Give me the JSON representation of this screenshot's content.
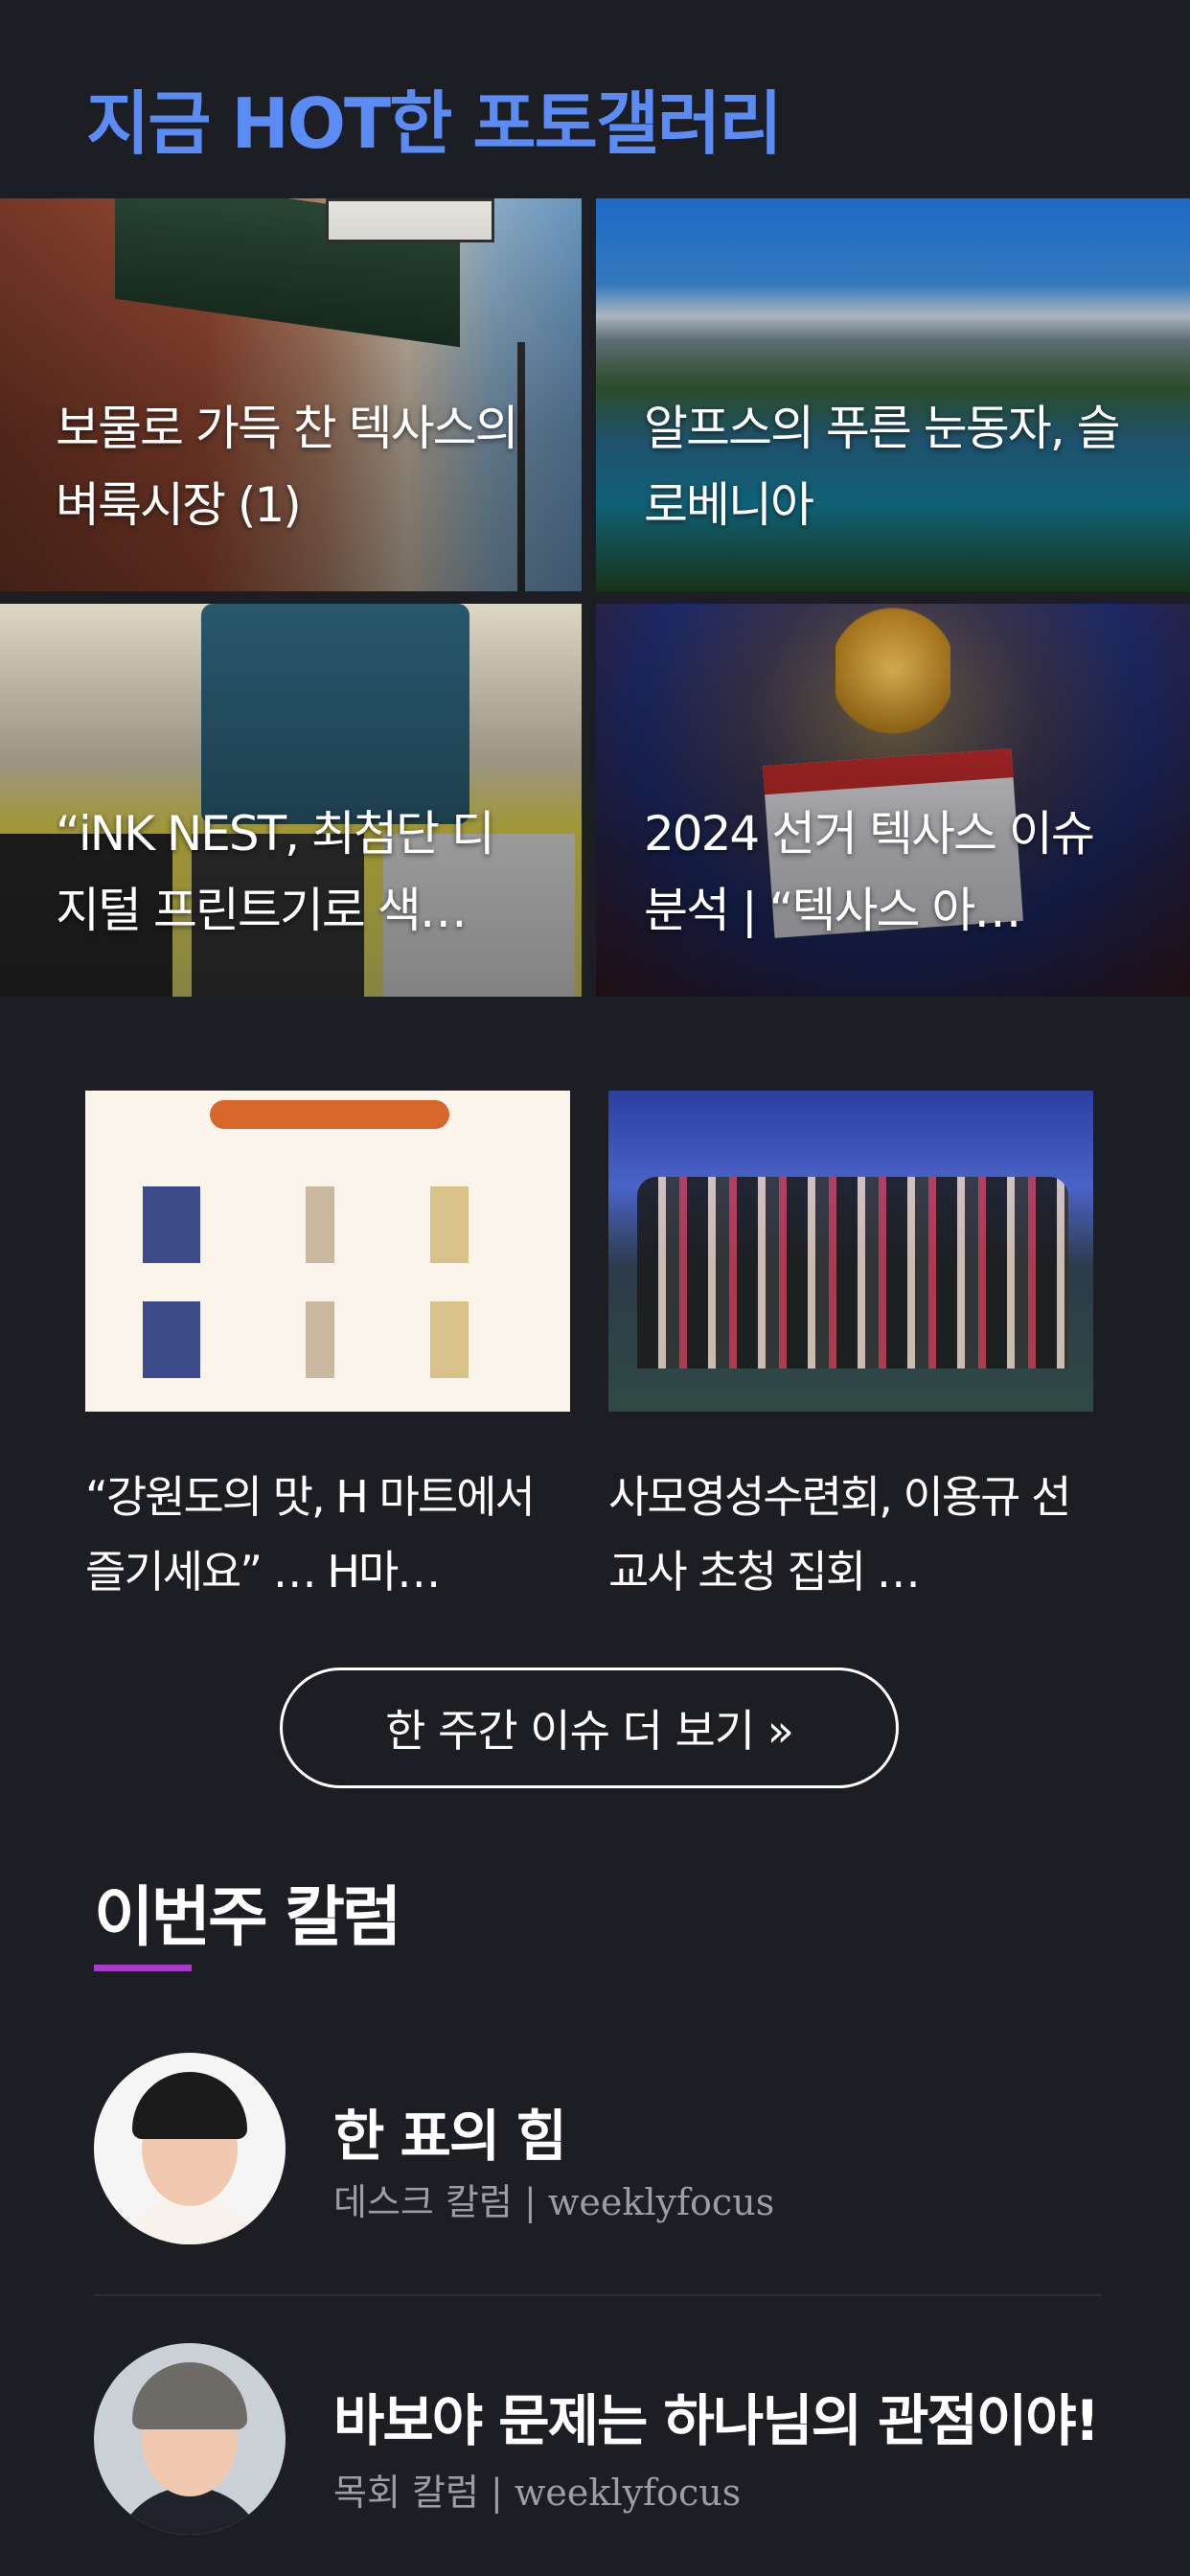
{
  "gallery": {
    "title": "지금 HOT한 포토갤러리",
    "tiles": [
      {
        "caption": "보물로 가득 찬 텍사스의 벼룩시장 (1)"
      },
      {
        "caption": "알프스의 푸른 눈동자, 슬로베니아"
      },
      {
        "caption": "“iNK NEST, 최첨단 디지털 프린트기로 색…"
      },
      {
        "caption": "2024 선거 텍사스 이슈 분석 | “텍사스 아…"
      }
    ]
  },
  "issues": {
    "cards": [
      {
        "title": "“강원도의 맛, H 마트에서 즐기세요” … H마…"
      },
      {
        "title": "사모영성수련회, 이용규 선교사 초청 집회 …"
      }
    ],
    "more_label": "한 주간 이슈 더 보기 »"
  },
  "columns": {
    "title": "이번주 칼럼",
    "accent_color": "#a63cc9",
    "items": [
      {
        "title": "한 표의 힘",
        "meta": "데스크 칼럼 | weeklyfocus"
      },
      {
        "title": "바보야 문제는 하나님의 관점이야!",
        "meta": "목회 칼럼 | weeklyfocus"
      }
    ]
  },
  "colors": {
    "background": "#1d1e23",
    "gallery_title": "#5b8cf5"
  }
}
